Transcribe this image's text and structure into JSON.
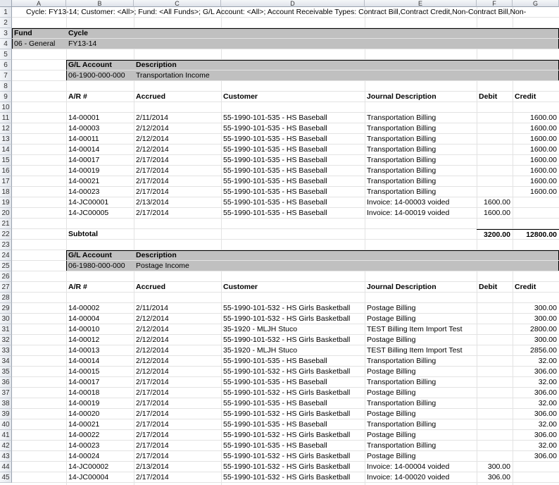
{
  "columns": [
    "A",
    "B",
    "C",
    "D",
    "E",
    "F",
    "G"
  ],
  "row1": "Cycle: FY13-14; Customer: <All>; Fund: <All Funds>; G/L Account: <All>; Account Receivable Types: Contract Bill,Contract Credit,Non-Contract Bill,Non-",
  "fund_header": {
    "fund_label": "Fund",
    "cycle_label": "Cycle",
    "fund_value": "06 - General",
    "cycle_value": "FY13-14"
  },
  "gl_label": "G/L Account",
  "desc_label": "Description",
  "headers": {
    "ar": "A/R #",
    "accrued": "Accrued",
    "customer": "Customer",
    "journal": "Journal Description",
    "debit": "Debit",
    "credit": "Credit"
  },
  "section1": {
    "gl_account": "06-1900-000-000",
    "description": "Transportation Income",
    "rows": [
      [
        "14-00001",
        "2/11/2014",
        "55-1990-101-535 - HS Baseball",
        "Transportation Billing",
        "",
        "1600.00"
      ],
      [
        "14-00003",
        "2/12/2014",
        "55-1990-101-535 - HS Baseball",
        "Transportation Billing",
        "",
        "1600.00"
      ],
      [
        "14-00011",
        "2/12/2014",
        "55-1990-101-535 - HS Baseball",
        "Transportation Billing",
        "",
        "1600.00"
      ],
      [
        "14-00014",
        "2/12/2014",
        "55-1990-101-535 - HS Baseball",
        "Transportation Billing",
        "",
        "1600.00"
      ],
      [
        "14-00017",
        "2/17/2014",
        "55-1990-101-535 - HS Baseball",
        "Transportation Billing",
        "",
        "1600.00"
      ],
      [
        "14-00019",
        "2/17/2014",
        "55-1990-101-535 - HS Baseball",
        "Transportation Billing",
        "",
        "1600.00"
      ],
      [
        "14-00021",
        "2/17/2014",
        "55-1990-101-535 - HS Baseball",
        "Transportation Billing",
        "",
        "1600.00"
      ],
      [
        "14-00023",
        "2/17/2014",
        "55-1990-101-535 - HS Baseball",
        "Transportation Billing",
        "",
        "1600.00"
      ],
      [
        "14-JC00001",
        "2/13/2014",
        "55-1990-101-535 - HS Baseball",
        "Invoice: 14-00003 voided",
        "1600.00",
        ""
      ],
      [
        "14-JC00005",
        "2/17/2014",
        "55-1990-101-535 - HS Baseball",
        "Invoice: 14-00019 voided",
        "1600.00",
        ""
      ]
    ],
    "subtotal_label": "Subtotal",
    "subtotal_debit": "3200.00",
    "subtotal_credit": "12800.00"
  },
  "section2": {
    "gl_account": "06-1980-000-000",
    "description": "Postage Income",
    "rows": [
      [
        "14-00002",
        "2/11/2014",
        "55-1990-101-532 - HS Girls Basketball",
        "Postage Billing",
        "",
        "300.00"
      ],
      [
        "14-00004",
        "2/12/2014",
        "55-1990-101-532 - HS Girls Basketball",
        "Postage Billing",
        "",
        "300.00"
      ],
      [
        "14-00010",
        "2/12/2014",
        "35-1920 - MLJH Stuco",
        "TEST Billing Item Import Test",
        "",
        "2800.00"
      ],
      [
        "14-00012",
        "2/12/2014",
        "55-1990-101-532 - HS Girls Basketball",
        "Postage Billing",
        "",
        "300.00"
      ],
      [
        "14-00013",
        "2/12/2014",
        "35-1920 - MLJH Stuco",
        "TEST Billing Item Import Test",
        "",
        "2856.00"
      ],
      [
        "14-00014",
        "2/12/2014",
        "55-1990-101-535 - HS Baseball",
        "Transportation Billing",
        "",
        "32.00"
      ],
      [
        "14-00015",
        "2/12/2014",
        "55-1990-101-532 - HS Girls Basketball",
        "Postage Billing",
        "",
        "306.00"
      ],
      [
        "14-00017",
        "2/17/2014",
        "55-1990-101-535 - HS Baseball",
        "Transportation Billing",
        "",
        "32.00"
      ],
      [
        "14-00018",
        "2/17/2014",
        "55-1990-101-532 - HS Girls Basketball",
        "Postage Billing",
        "",
        "306.00"
      ],
      [
        "14-00019",
        "2/17/2014",
        "55-1990-101-535 - HS Baseball",
        "Transportation Billing",
        "",
        "32.00"
      ],
      [
        "14-00020",
        "2/17/2014",
        "55-1990-101-532 - HS Girls Basketball",
        "Postage Billing",
        "",
        "306.00"
      ],
      [
        "14-00021",
        "2/17/2014",
        "55-1990-101-535 - HS Baseball",
        "Transportation Billing",
        "",
        "32.00"
      ],
      [
        "14-00022",
        "2/17/2014",
        "55-1990-101-532 - HS Girls Basketball",
        "Postage Billing",
        "",
        "306.00"
      ],
      [
        "14-00023",
        "2/17/2014",
        "55-1990-101-535 - HS Baseball",
        "Transportation Billing",
        "",
        "32.00"
      ],
      [
        "14-00024",
        "2/17/2014",
        "55-1990-101-532 - HS Girls Basketball",
        "Postage Billing",
        "",
        "306.00"
      ],
      [
        "14-JC00002",
        "2/13/2014",
        "55-1990-101-532 - HS Girls Basketball",
        "Invoice: 14-00004 voided",
        "300.00",
        ""
      ],
      [
        "14-JC00004",
        "2/17/2014",
        "55-1990-101-532 - HS Girls Basketball",
        "Invoice: 14-00020 voided",
        "306.00",
        ""
      ]
    ]
  }
}
